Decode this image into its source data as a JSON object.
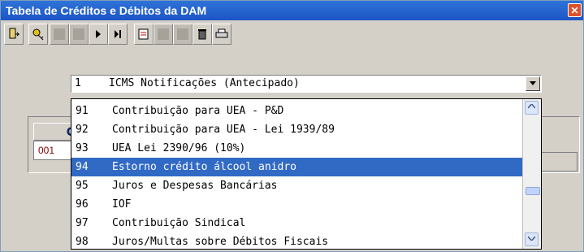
{
  "window": {
    "title": "Tabela de Créditos e Débitos da DAM",
    "close_glyph": "✕"
  },
  "toolbar": {
    "icons": [
      "exit-icon",
      "key-icon",
      "first-record-icon",
      "previous-record-icon",
      "next-record-icon",
      "last-record-icon",
      "edit-icon",
      "save-icon",
      "cancel-icon",
      "delete-icon",
      "print-icon"
    ]
  },
  "combo": {
    "selected_code": "1",
    "selected_text": "ICMS Notificações (Antecipado)"
  },
  "grid": {
    "header": "C",
    "cell": "001"
  },
  "dropdown": {
    "items": [
      {
        "code": "91",
        "text": "Contribuição para UEA - P&D"
      },
      {
        "code": "92",
        "text": "Contribuição para UEA - Lei 1939/89"
      },
      {
        "code": "93",
        "text": "UEA Lei 2390/96 (10%)"
      },
      {
        "code": "94",
        "text": "Estorno crédito álcool anidro"
      },
      {
        "code": "95",
        "text": "Juros e Despesas Bancárias"
      },
      {
        "code": "96",
        "text": "IOF"
      },
      {
        "code": "97",
        "text": "Contribuição Sindical"
      },
      {
        "code": "98",
        "text": "Juros/Multas sobre Débitos Fiscais"
      }
    ],
    "selected_index": 3
  },
  "colors": {
    "selection": "#316ac5",
    "titlebar": "#2f73d8"
  }
}
